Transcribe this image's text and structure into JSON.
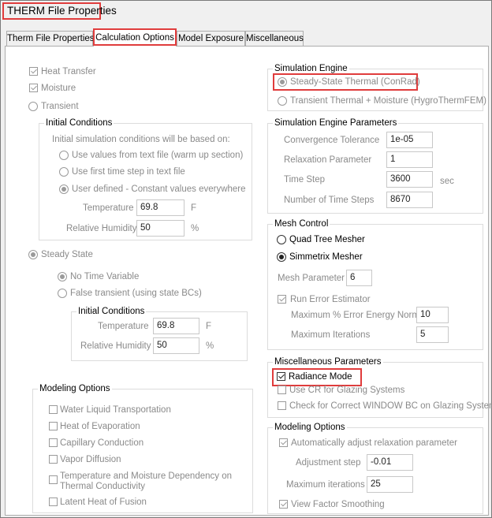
{
  "window": {
    "title": "THERM File Properties"
  },
  "tabs": [
    {
      "label": "Therm File Properties"
    },
    {
      "label": "Calculation Options"
    },
    {
      "label": "Model Exposure"
    },
    {
      "label": "Miscellaneous"
    }
  ],
  "left": {
    "heat_transfer": "Heat Transfer",
    "moisture": "Moisture",
    "transient": "Transient",
    "initial_conditions": {
      "title": "Initial Conditions",
      "note": "Initial simulation conditions will be based on:",
      "opt1": "Use values from text file (warm up section)",
      "opt2": "Use first time step in text file",
      "opt3": "User defined - Constant values everywhere",
      "temperature_label": "Temperature",
      "temperature_value": "69.8",
      "temperature_unit": "F",
      "rh_label": "Relative Humidity",
      "rh_value": "50",
      "rh_unit": "%"
    },
    "steady_state": "Steady State",
    "no_time_variable": "No Time Variable",
    "false_transient": "False transient (using state BCs)",
    "ss_initial": {
      "title": "Initial Conditions",
      "temperature_label": "Temperature",
      "temperature_value": "69.8",
      "temperature_unit": "F",
      "rh_label": "Relative Humidity",
      "rh_value": "50",
      "rh_unit": "%"
    },
    "modeling_options": {
      "title": "Modeling Options",
      "items": [
        "Water Liquid Transportation",
        "Heat of Evaporation",
        "Capillary Conduction",
        "Vapor Diffusion",
        "Temperature and Moisture Dependency on",
        "Thermal Conductivity",
        "Latent Heat of Fusion"
      ]
    }
  },
  "right": {
    "simulation_engine": {
      "title": "Simulation Engine",
      "steady": "Steady-State Thermal (ConRad)",
      "transient": "Transient Thermal + Moisture (HygroThermFEM)"
    },
    "engine_params": {
      "title": "Simulation Engine Parameters",
      "convergence_label": "Convergence Tolerance",
      "convergence_value": "1e-05",
      "relaxation_label": "Relaxation Parameter",
      "relaxation_value": "1",
      "timestep_label": "Time Step",
      "timestep_value": "3600",
      "timestep_unit": "sec",
      "numsteps_label": "Number of Time Steps",
      "numsteps_value": "8670"
    },
    "mesh_control": {
      "title": "Mesh Control",
      "quadtree": "Quad Tree Mesher",
      "simmetrix": "Simmetrix Mesher",
      "mesh_param_label": "Mesh Parameter",
      "mesh_param_value": "6",
      "run_error": "Run Error Estimator",
      "max_error_label": "Maximum % Error Energy Norm",
      "max_error_value": "10",
      "max_iter_label": "Maximum Iterations",
      "max_iter_value": "5"
    },
    "misc_params": {
      "title": "Miscellaneous Parameters",
      "radiance": "Radiance Mode",
      "use_cr": "Use CR for Glazing Systems",
      "check_window": "Check for Correct WINDOW BC on Glazing Systems"
    },
    "modeling_options": {
      "title": "Modeling Options",
      "auto_adjust": "Automatically adjust relaxation parameter",
      "adj_step_label": "Adjustment step",
      "adj_step_value": "-0.01",
      "max_iter_label": "Maximum iterations",
      "max_iter_value": "25",
      "view_factor": "View Factor Smoothing"
    }
  }
}
